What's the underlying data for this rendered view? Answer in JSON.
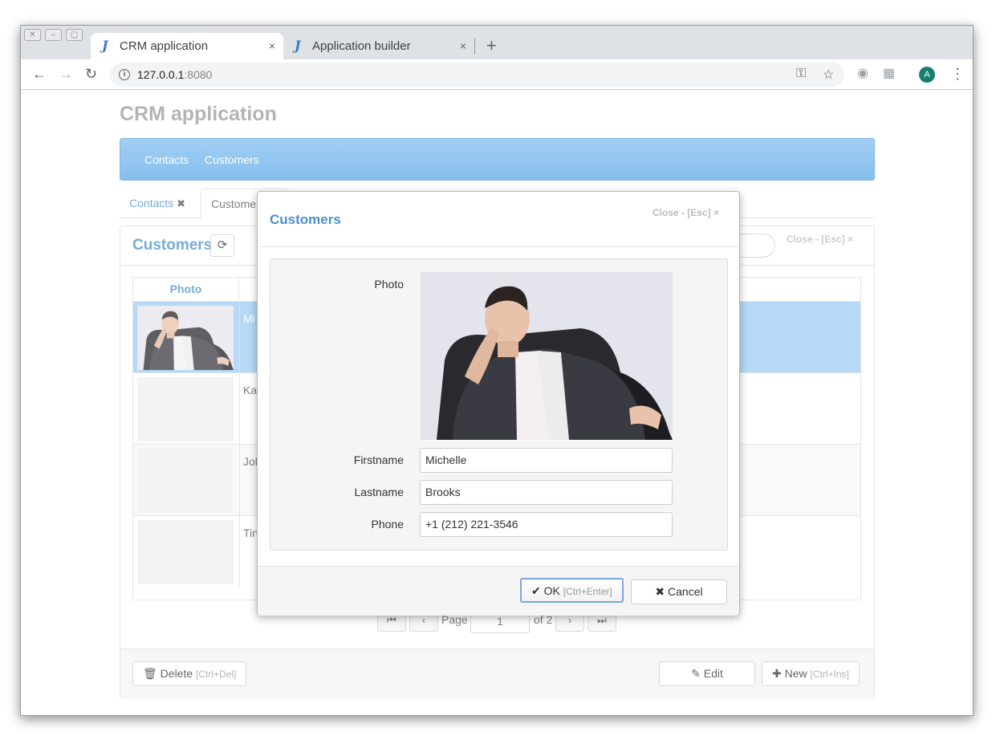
{
  "browser": {
    "tabs": [
      {
        "title": "CRM application",
        "favicon": "J",
        "close": "×"
      },
      {
        "title": "Application builder",
        "favicon": "J",
        "close": "×"
      }
    ],
    "new_tab": "+",
    "url_host": "127.0.0.1",
    "url_port": ":8080",
    "avatar_letter": "A"
  },
  "app": {
    "title": "CRM application",
    "nav": [
      "Contacts",
      "Customers"
    ],
    "tabs": [
      {
        "label": "Contacts",
        "close": "✖"
      },
      {
        "label": "Custome"
      }
    ]
  },
  "panel": {
    "title": "Customers",
    "close_hint": "Close - [Esc] ×",
    "grid": {
      "photo_header": "Photo",
      "rows": [
        {
          "text": "Mi",
          "selected": true
        },
        {
          "text": "Ka"
        },
        {
          "text": "Jol"
        },
        {
          "text": "Tin"
        }
      ]
    },
    "pager": {
      "label": "Page",
      "page": "1",
      "of": "of 2"
    },
    "footer": {
      "delete_label": "Delete",
      "delete_hint": "[Ctrl+Del]",
      "edit_label": "Edit",
      "new_label": "New",
      "new_hint": "[Ctrl+Ins]"
    }
  },
  "modal": {
    "title": "Customers",
    "close_hint": "Close - [Esc] ×",
    "fields": {
      "photo_label": "Photo",
      "firstname_label": "Firstname",
      "firstname_value": "Michelle",
      "lastname_label": "Lastname",
      "lastname_value": "Brooks",
      "phone_label": "Phone",
      "phone_value": "+1 (212) 221-3546"
    },
    "ok_label": "OK",
    "ok_hint": "[Ctrl+Enter]",
    "cancel_label": "Cancel"
  },
  "colors": {
    "accent": "#4a90c8",
    "navbar": "#6fb3ec",
    "selected_row": "#9ccdf3"
  },
  "icons": [
    "back-arrow-icon",
    "forward-arrow-icon",
    "reload-icon",
    "info-icon",
    "key-icon",
    "star-icon",
    "globe-icon",
    "extensions-icon",
    "kebab-menu-icon",
    "refresh-icon",
    "trash-icon",
    "edit-icon",
    "plus-icon",
    "check-icon",
    "times-icon"
  ]
}
